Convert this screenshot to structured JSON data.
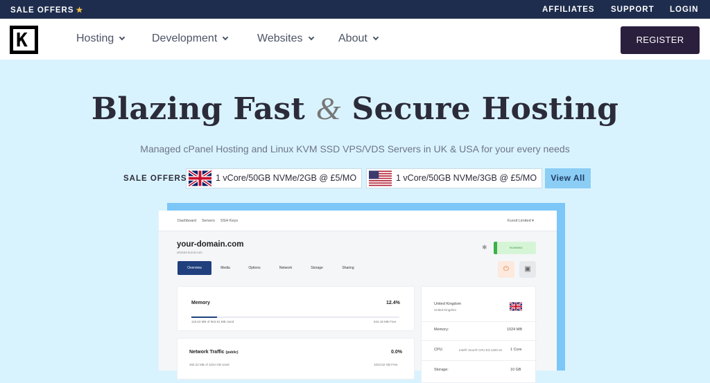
{
  "topbar": {
    "sale": "SALE OFFERS",
    "affiliates": "AFFILIATES",
    "support": "SUPPORT",
    "login": "LOGIN"
  },
  "nav": {
    "items": [
      "Hosting",
      "Development",
      "Websites",
      "About"
    ],
    "register": "REGISTER"
  },
  "hero": {
    "title_a": "Blazing Fast",
    "amp": "&",
    "title_b": "Secure Hosting",
    "subtitle": "Managed cPanel Hosting and Linux KVM SSD VPS/VDS Servers in UK & USA for your every needs"
  },
  "offers": {
    "label": "SALE OFFERS:",
    "uk": "1 vCore/50GB NVMe/2GB @ £5/MO",
    "us": "1 vCore/50GB NVMe/3GB @ £5/MO",
    "view_all": "View All"
  },
  "panel": {
    "nav": [
      "Dashboard",
      "Servers",
      "SSH Keys"
    ],
    "account": "Kuroit Limited ▾",
    "domain": "your-domain.com",
    "domain_sub": "uk1634.kuroit.com",
    "status": "RUNNING",
    "tabs": [
      "Overview",
      "Media",
      "Options",
      "Network",
      "Storage",
      "Sharing"
    ],
    "memory": {
      "title": "Memory",
      "percent": "12.4%",
      "used": "119.63 MB of 963.81 MB Used",
      "free": "844.18 MB Free",
      "fill": 0.124
    },
    "traffic": {
      "title": "Network Traffic",
      "qualifier": "(public)",
      "percent": "0.0%",
      "used": "492.22 MB of 1024 GB Used",
      "free": "1023.52 GB Free"
    },
    "location": {
      "country": "United Kingdom",
      "sub": "United Kingdom"
    },
    "specs": [
      {
        "label": "Memory:",
        "value": "1024 MB",
        "extra": ""
      },
      {
        "label": "CPU:",
        "value": "1 Core",
        "extra": "Intel® Xeon® CPU E3-1200 v6"
      },
      {
        "label": "Storage:",
        "value": "10 GB",
        "extra": ""
      }
    ]
  },
  "colors": {
    "topbar": "#1e2d4d",
    "register": "#2a1f3d",
    "hero_bg": "#d9f3fe",
    "accent": "#1f3f7d",
    "view_all": "#8bcdf5"
  }
}
